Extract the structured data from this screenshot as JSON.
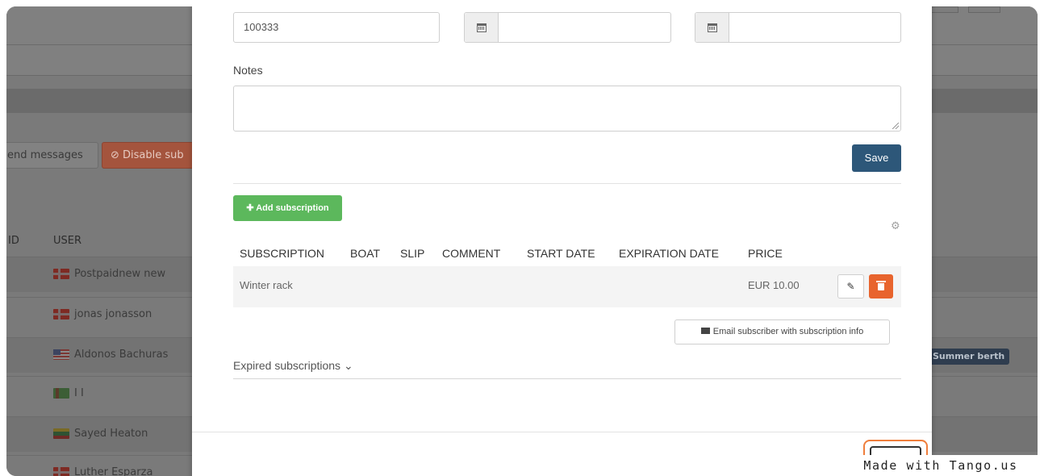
{
  "background": {
    "buttons": {
      "send_messages": "end messages",
      "disable": "⊘ Disable sub"
    },
    "table_headers": {
      "id": "ID",
      "user": "USER"
    },
    "users": [
      {
        "name": "Postpaidnew new",
        "flag": "denmark-flag"
      },
      {
        "name": "jonas jonasson",
        "flag": "denmark-flag"
      },
      {
        "name": "Aldonos Bachuras",
        "flag": "usa-flag"
      },
      {
        "name": "I I",
        "flag": "turkmenistan-flag"
      },
      {
        "name": "Sayed Heaton",
        "flag": "lithuania-flag"
      },
      {
        "name": "Luther Esparza",
        "flag": "denmark-flag"
      }
    ],
    "badge": "Summer berth"
  },
  "modal": {
    "fields": {
      "number_value": "100333",
      "start_date_value": "",
      "end_date_value": ""
    },
    "notes_label": "Notes",
    "notes_value": "",
    "save_label": "Save",
    "add_subscription_label": "✚ Add subscription",
    "table": {
      "headers": [
        "SUBSCRIPTION",
        "BOAT",
        "SLIP",
        "COMMENT",
        "START DATE",
        "EXPIRATION DATE",
        "PRICE"
      ],
      "rows": [
        {
          "subscription": "Winter rack",
          "boat": "",
          "slip": "",
          "comment": "",
          "start_date": "",
          "expiration_date": "",
          "price": "EUR 10.00"
        }
      ]
    },
    "email_label": "Email subscriber with subscription info",
    "expired_label": "Expired subscriptions ⌄"
  },
  "watermark": "Made with Tango.us",
  "colors": {
    "primary": "#2d5779",
    "success": "#5cb85c",
    "danger": "#e8642d",
    "highlight": "#ef7e3c"
  }
}
